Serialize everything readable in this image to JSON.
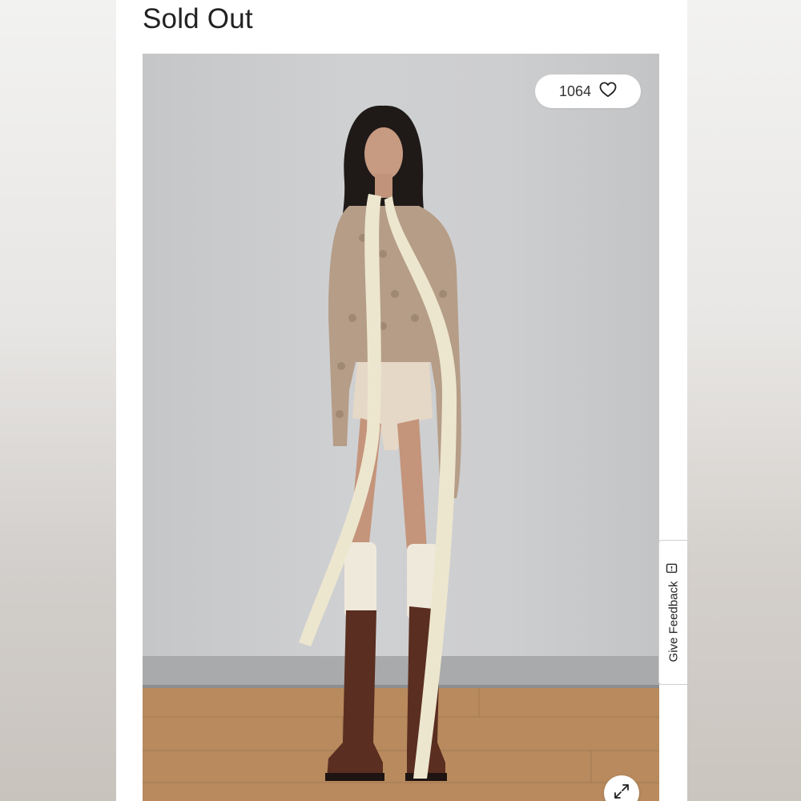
{
  "product": {
    "status_label": "Sold Out"
  },
  "likes": {
    "count": "1064",
    "icon": "heart-icon"
  },
  "feedback": {
    "label": "Give Feedback",
    "icon": "feedback-icon"
  },
  "gallery": {
    "expand_icon": "expand-icon"
  },
  "colors": {
    "page_bg": "#ffffff",
    "text": "#222222",
    "photo_backdrop": "#cbcccd"
  }
}
